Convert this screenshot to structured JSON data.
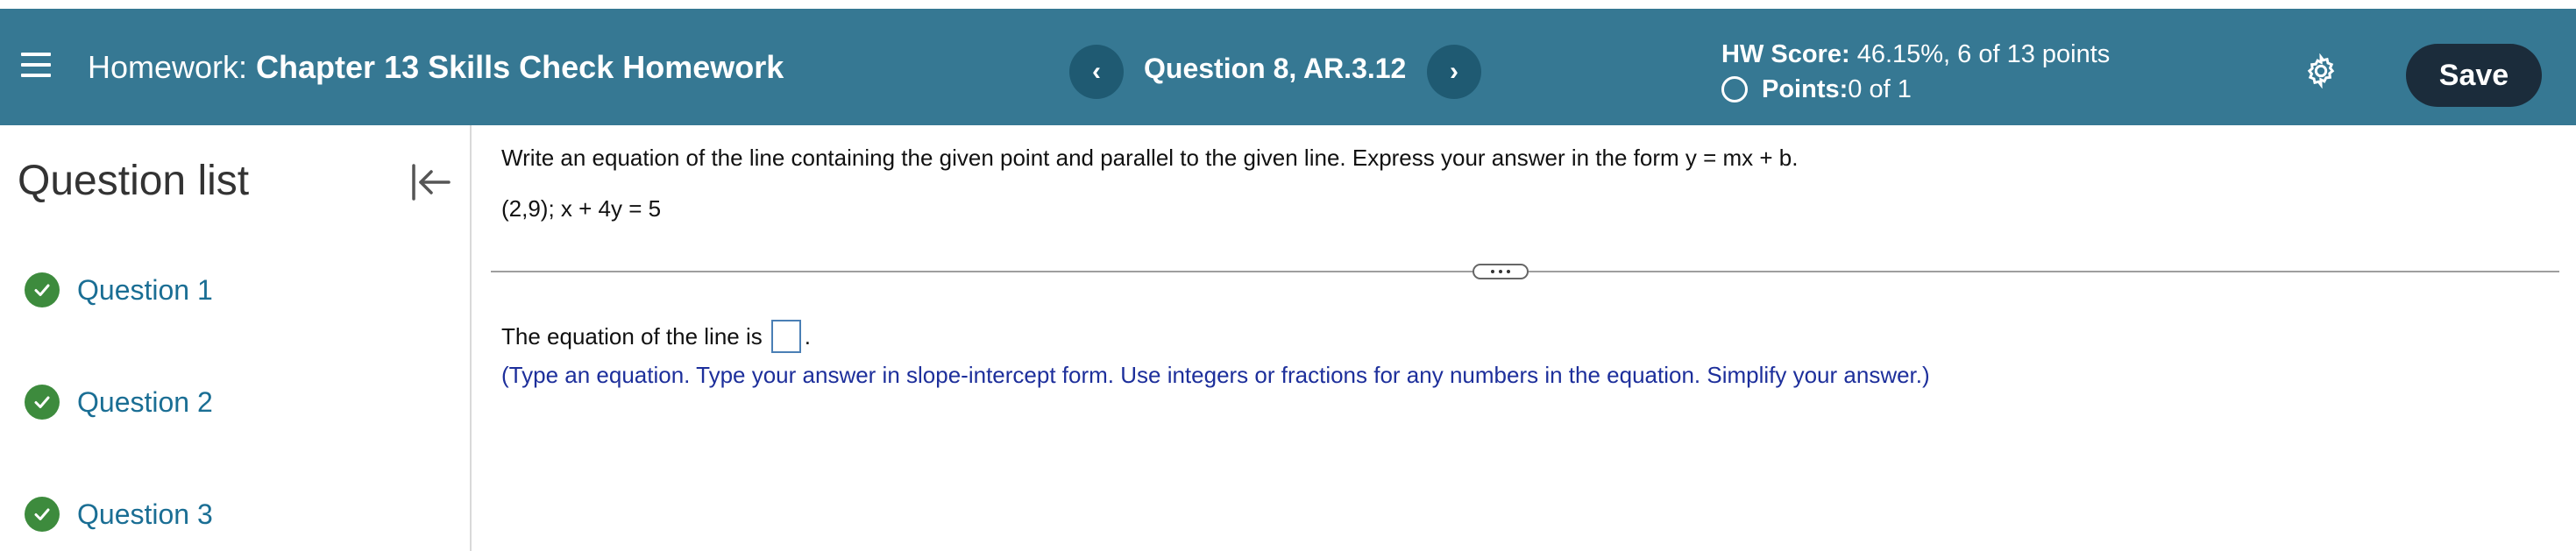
{
  "header": {
    "hw_prefix": "Homework:",
    "hw_name": "Chapter 13 Skills Check Homework",
    "question_label": "Question 8, AR.3.12",
    "prev_symbol": "‹",
    "next_symbol": "›",
    "score_label": "HW Score:",
    "score_value": " 46.15%, 6 of 13 points",
    "points_label": "Points:",
    "points_value": " 0 of 1",
    "save_label": "Save",
    "icons": [
      "menu-icon",
      "chevron-left-icon",
      "chevron-right-icon",
      "gear-icon"
    ]
  },
  "sidebar": {
    "title": "Question list",
    "collapse_icon": "collapse-left-icon",
    "items": [
      {
        "label": "Question 1",
        "status": "complete"
      },
      {
        "label": "Question 2",
        "status": "complete"
      },
      {
        "label": "Question 3",
        "status": "complete"
      }
    ]
  },
  "main": {
    "prompt": "Write an equation of the line containing the given point and parallel to the given line. Express your answer in the form y = mx + b.",
    "given": "(2,9); x + 4y = 5",
    "answer_prefix": "The equation of the line is",
    "answer_value": "",
    "answer_suffix": ".",
    "instruction": "(Type an equation. Type your answer in slope-intercept form. Use integers or fractions for any numbers in the equation. Simplify your answer.)"
  },
  "colors": {
    "header_bg": "#367893",
    "save_bg": "#1b2c3b",
    "check_green": "#3d8b3d",
    "link_blue": "#1a6e94",
    "instruction_blue": "#1d2f9b"
  }
}
